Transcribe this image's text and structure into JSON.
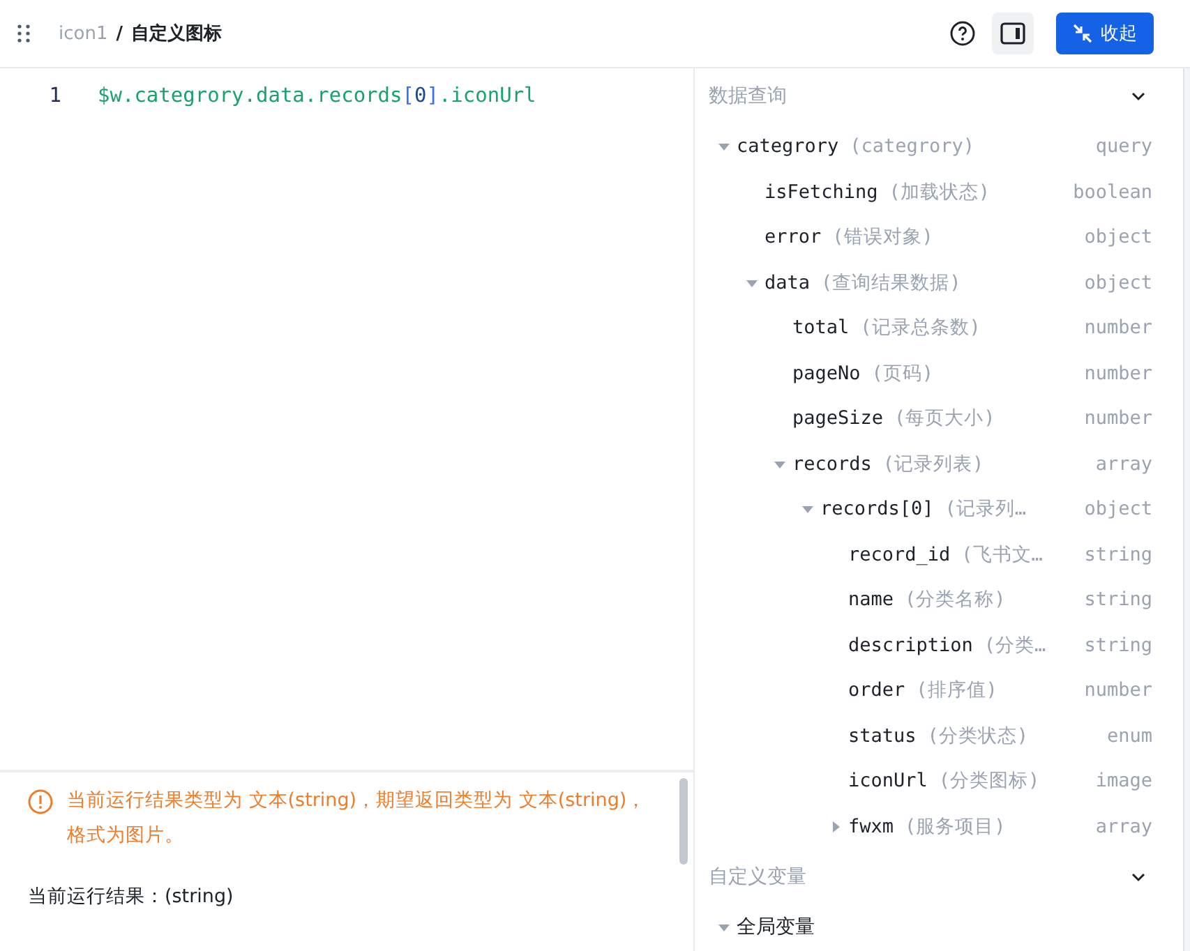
{
  "header": {
    "component": "icon1",
    "separator": "/",
    "title": "自定义图标",
    "collapse_button": "收起"
  },
  "editor": {
    "lines": [
      {
        "number": "1",
        "tokens": [
          {
            "text": "$w.categrory.data.records",
            "kind": "ident"
          },
          {
            "text": "[",
            "kind": "bracket"
          },
          {
            "text": "0",
            "kind": "number"
          },
          {
            "text": "]",
            "kind": "bracket"
          },
          {
            "text": ".iconUrl",
            "kind": "ident"
          }
        ]
      }
    ]
  },
  "result": {
    "warning": "当前运行结果类型为 文本(string)，期望返回类型为 文本(string)，格式为图片。",
    "output_label": "当前运行结果：",
    "output_value": "(string)"
  },
  "sections": [
    {
      "title": "数据查询",
      "expanded": true,
      "tree": [
        {
          "name": "categrory",
          "desc": "(categrory)",
          "type": "query",
          "expanded": true,
          "children": [
            {
              "name": "isFetching",
              "desc": "(加载状态)",
              "type": "boolean"
            },
            {
              "name": "error",
              "desc": "(错误对象)",
              "type": "object"
            },
            {
              "name": "data",
              "desc": "(查询结果数据)",
              "type": "object",
              "expanded": true,
              "children": [
                {
                  "name": "total",
                  "desc": "(记录总条数)",
                  "type": "number"
                },
                {
                  "name": "pageNo",
                  "desc": "(页码)",
                  "type": "number"
                },
                {
                  "name": "pageSize",
                  "desc": "(每页大小)",
                  "type": "number"
                },
                {
                  "name": "records",
                  "desc": "(记录列表)",
                  "type": "array",
                  "expanded": true,
                  "children": [
                    {
                      "name": "records[0]",
                      "desc": "(记录列…",
                      "type": "object",
                      "expanded": true,
                      "children": [
                        {
                          "name": "record_id",
                          "desc": "(飞书文…",
                          "type": "string"
                        },
                        {
                          "name": "name",
                          "desc": "(分类名称)",
                          "type": "string"
                        },
                        {
                          "name": "description",
                          "desc": "(分类…",
                          "type": "string"
                        },
                        {
                          "name": "order",
                          "desc": "(排序值)",
                          "type": "number"
                        },
                        {
                          "name": "status",
                          "desc": "(分类状态)",
                          "type": "enum"
                        },
                        {
                          "name": "iconUrl",
                          "desc": "(分类图标)",
                          "type": "image"
                        },
                        {
                          "name": "fwxm",
                          "desc": "(服务项目)",
                          "type": "array",
                          "expanded": false
                        }
                      ]
                    }
                  ]
                }
              ]
            }
          ]
        }
      ]
    },
    {
      "title": "自定义变量",
      "expanded": true,
      "tree": [
        {
          "name": "全局变量",
          "expanded": true
        }
      ]
    }
  ]
}
